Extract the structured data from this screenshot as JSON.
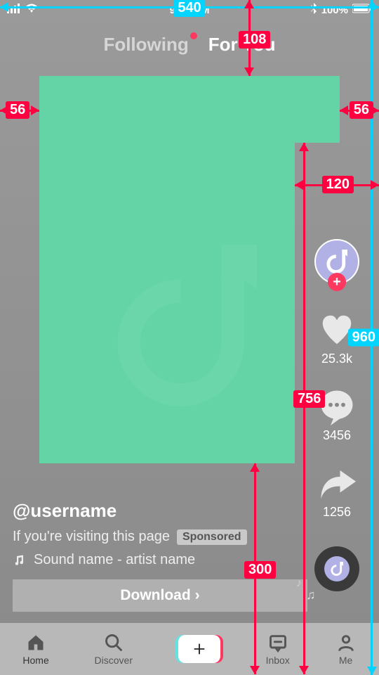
{
  "statusbar": {
    "time": "9:41 AM",
    "battery": "100%"
  },
  "tabs": {
    "following": "Following",
    "foryou": "For You"
  },
  "rail": {
    "likes": "25.3k",
    "comments": "3456",
    "shares": "1256"
  },
  "meta": {
    "username": "@username",
    "caption": "If you're visiting this page",
    "sponsored": "Sponsored",
    "sound": "Sound name - artist name",
    "cta": "Download"
  },
  "nav": {
    "home": "Home",
    "discover": "Discover",
    "inbox": "Inbox",
    "me": "Me"
  },
  "dims": {
    "w": "540",
    "h": "960",
    "left": "56",
    "right": "56",
    "top": "108",
    "rail_w": "120",
    "rail_h": "756",
    "meta_h": "300"
  }
}
